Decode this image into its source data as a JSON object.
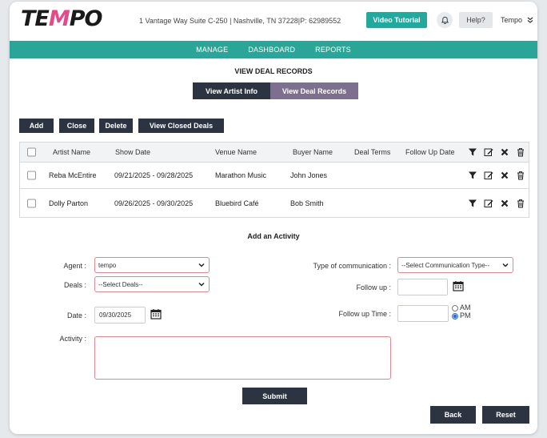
{
  "header": {
    "logo": {
      "pre": "TE",
      "mid": "M",
      "post": "PO"
    },
    "address": "1 Vantage Way Suite C-250 | Nashville, TN 37228|P: 62989552",
    "video_tutorial": "Video Tutorial",
    "help": "Help?",
    "user": "Tempo"
  },
  "nav": {
    "items": [
      "MANAGE",
      "DASHBOARD",
      "REPORTS"
    ]
  },
  "page": {
    "title": "VIEW DEAL RECORDS",
    "view_artist_info": "View Artist Info",
    "view_deal_records": "View Deal Records"
  },
  "toolbar": {
    "add": "Add",
    "close": "Close",
    "delete": "Delete",
    "view_closed": "View Closed Deals"
  },
  "table": {
    "headers": [
      "Artist Name",
      "Show Date",
      "Venue Name",
      "Buyer Name",
      "Deal Terms",
      "Follow Up Date"
    ],
    "rows": [
      {
        "artist": "Reba McEntire",
        "show_date": "09/21/2025 - 09/28/2025",
        "venue": "Marathon Music",
        "buyer": "John Jones",
        "terms": "",
        "follow_up": ""
      },
      {
        "artist": "Dolly Parton",
        "show_date": "09/26/2025 - 09/30/2025",
        "venue": "Bluebird Café",
        "buyer": "Bob Smith",
        "terms": "",
        "follow_up": ""
      }
    ]
  },
  "activity": {
    "title": "Add an Activity",
    "agent_label": "Agent :",
    "agent_value": "tempo",
    "deals_label": "Deals :",
    "deals_value": "--Select Deals--",
    "date_label": "Date :",
    "date_value": "09/30/2025",
    "activity_label": "Activity :",
    "activity_value": "",
    "comm_label": "Type of communication :",
    "comm_value": "--Select Communication Type--",
    "followup_label": "Follow up :",
    "followup_value": "",
    "followup_time_label": "Follow up Time :",
    "followup_time_value": "",
    "am": "AM",
    "pm": "PM",
    "selected_period": "PM",
    "submit": "Submit",
    "back": "Back",
    "reset": "Reset"
  },
  "colors": {
    "teal": "#2aa597",
    "dark": "#2c3442",
    "purple": "#7c6f8f",
    "error_border": "#e8848a",
    "logo_accent": "#e24a8a"
  }
}
